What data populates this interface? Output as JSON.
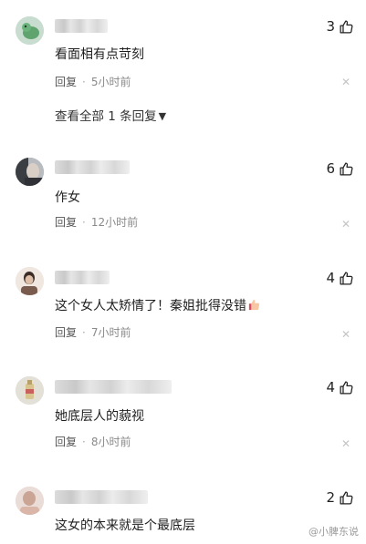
{
  "comments": [
    {
      "avatar": "green-cartoon-avatar",
      "text": "看面相有点苛刻",
      "reply_label": "回复",
      "time": "5小时前",
      "likes": "3",
      "view_all": "查看全部 1 条回复"
    },
    {
      "avatar": "dark-portrait-avatar",
      "text": "作女",
      "reply_label": "回复",
      "time": "12小时前",
      "likes": "6"
    },
    {
      "avatar": "person-avatar",
      "text": "这个女人太矫情了！秦姐批得没错",
      "reply_label": "回复",
      "time": "7小时前",
      "likes": "4",
      "emoji": "thumbs-up-emoji"
    },
    {
      "avatar": "bottle-avatar",
      "text": "她底层人的藐视",
      "reply_label": "回复",
      "time": "8小时前",
      "likes": "4"
    },
    {
      "avatar": "pink-portrait-avatar",
      "text": "这女的本来就是个最底层",
      "likes": "2"
    }
  ],
  "watermark": "@小脾东说",
  "colors": {
    "text": "#1f1f1f",
    "meta": "#8a8a8a",
    "close": "#c4c4c4"
  },
  "icons": {
    "like": "thumbs-up-outline-icon",
    "close": "close-icon",
    "expand": "chevron-down-icon"
  }
}
